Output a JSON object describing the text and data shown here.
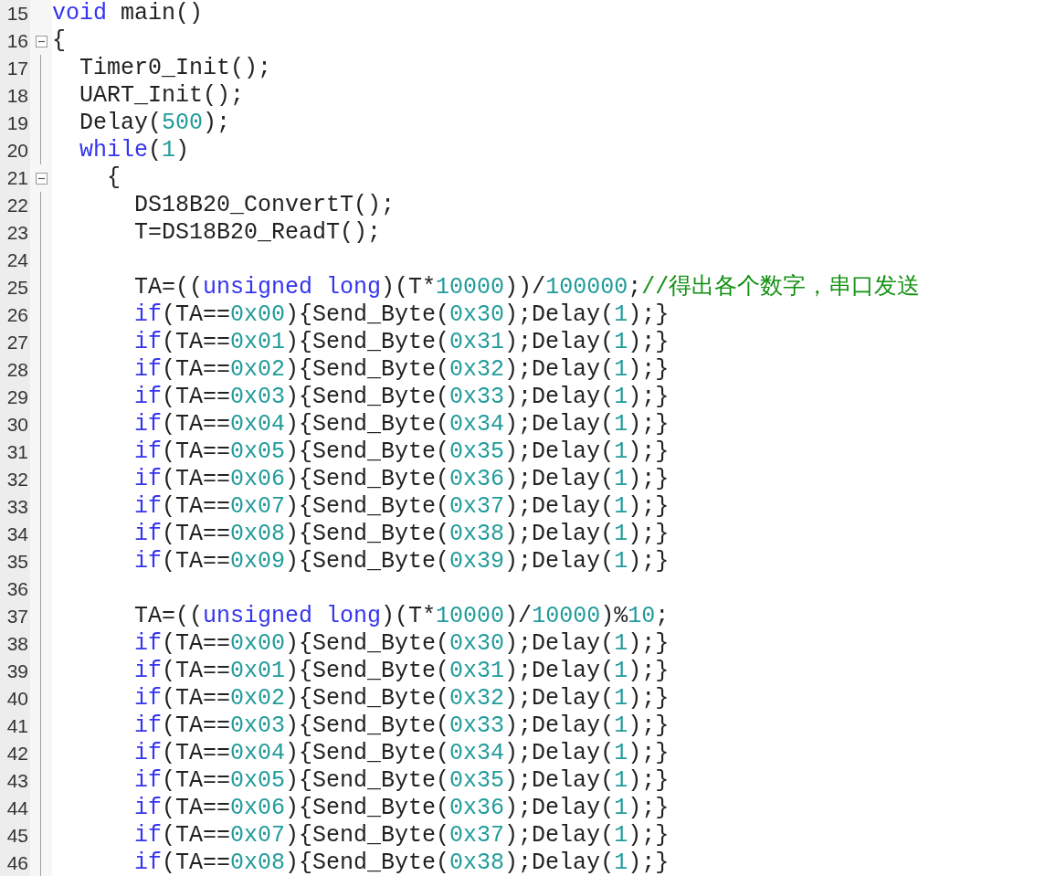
{
  "editor": {
    "lines": [
      {
        "number": "15",
        "fold_marker": false,
        "tokens": [
          {
            "kind": "keyword",
            "text": "void"
          },
          {
            "kind": "plain",
            "text": " main()"
          }
        ]
      },
      {
        "number": "16",
        "fold_marker": true,
        "tokens": [
          {
            "kind": "plain",
            "text": "{"
          }
        ]
      },
      {
        "number": "17",
        "fold_marker": false,
        "tokens": [
          {
            "kind": "plain",
            "text": "  Timer0_Init();"
          }
        ]
      },
      {
        "number": "18",
        "fold_marker": false,
        "tokens": [
          {
            "kind": "plain",
            "text": "  UART_Init();"
          }
        ]
      },
      {
        "number": "19",
        "fold_marker": false,
        "tokens": [
          {
            "kind": "plain",
            "text": "  Delay("
          },
          {
            "kind": "number",
            "text": "500"
          },
          {
            "kind": "plain",
            "text": ");"
          }
        ]
      },
      {
        "number": "20",
        "fold_marker": false,
        "tokens": [
          {
            "kind": "keyword",
            "text": "  while"
          },
          {
            "kind": "plain",
            "text": "("
          },
          {
            "kind": "number",
            "text": "1"
          },
          {
            "kind": "plain",
            "text": ")"
          }
        ]
      },
      {
        "number": "21",
        "fold_marker": true,
        "tokens": [
          {
            "kind": "plain",
            "text": "    {"
          }
        ]
      },
      {
        "number": "22",
        "fold_marker": false,
        "tokens": [
          {
            "kind": "plain",
            "text": "      DS18B20_ConvertT();"
          }
        ]
      },
      {
        "number": "23",
        "fold_marker": false,
        "tokens": [
          {
            "kind": "plain",
            "text": "      T=DS18B20_ReadT();"
          }
        ]
      },
      {
        "number": "24",
        "fold_marker": false
      },
      {
        "number": "25",
        "fold_marker": false,
        "tokens": [
          {
            "kind": "plain",
            "text": "      TA=(("
          },
          {
            "kind": "keyword",
            "text": "unsigned long"
          },
          {
            "kind": "plain",
            "text": ")(T*"
          },
          {
            "kind": "number",
            "text": "10000"
          },
          {
            "kind": "plain",
            "text": "))/"
          },
          {
            "kind": "number",
            "text": "100000"
          },
          {
            "kind": "plain",
            "text": ";"
          },
          {
            "kind": "comment",
            "text": "//得出各个数字，串口发送"
          }
        ]
      },
      {
        "number": "26",
        "fold_marker": false,
        "tokens": [
          {
            "kind": "keyword",
            "text": "      if"
          },
          {
            "kind": "plain",
            "text": "(TA=="
          },
          {
            "kind": "number",
            "text": "0x00"
          },
          {
            "kind": "plain",
            "text": "){Send_Byte("
          },
          {
            "kind": "number",
            "text": "0x30"
          },
          {
            "kind": "plain",
            "text": ");Delay("
          },
          {
            "kind": "number",
            "text": "1"
          },
          {
            "kind": "plain",
            "text": ");}"
          }
        ]
      },
      {
        "number": "27",
        "fold_marker": false,
        "tokens": [
          {
            "kind": "keyword",
            "text": "      if"
          },
          {
            "kind": "plain",
            "text": "(TA=="
          },
          {
            "kind": "number",
            "text": "0x01"
          },
          {
            "kind": "plain",
            "text": "){Send_Byte("
          },
          {
            "kind": "number",
            "text": "0x31"
          },
          {
            "kind": "plain",
            "text": ");Delay("
          },
          {
            "kind": "number",
            "text": "1"
          },
          {
            "kind": "plain",
            "text": ");}"
          }
        ]
      },
      {
        "number": "28",
        "fold_marker": false,
        "tokens": [
          {
            "kind": "keyword",
            "text": "      if"
          },
          {
            "kind": "plain",
            "text": "(TA=="
          },
          {
            "kind": "number",
            "text": "0x02"
          },
          {
            "kind": "plain",
            "text": "){Send_Byte("
          },
          {
            "kind": "number",
            "text": "0x32"
          },
          {
            "kind": "plain",
            "text": ");Delay("
          },
          {
            "kind": "number",
            "text": "1"
          },
          {
            "kind": "plain",
            "text": ");}"
          }
        ]
      },
      {
        "number": "29",
        "fold_marker": false,
        "tokens": [
          {
            "kind": "keyword",
            "text": "      if"
          },
          {
            "kind": "plain",
            "text": "(TA=="
          },
          {
            "kind": "number",
            "text": "0x03"
          },
          {
            "kind": "plain",
            "text": "){Send_Byte("
          },
          {
            "kind": "number",
            "text": "0x33"
          },
          {
            "kind": "plain",
            "text": ");Delay("
          },
          {
            "kind": "number",
            "text": "1"
          },
          {
            "kind": "plain",
            "text": ");}"
          }
        ]
      },
      {
        "number": "30",
        "fold_marker": false,
        "tokens": [
          {
            "kind": "keyword",
            "text": "      if"
          },
          {
            "kind": "plain",
            "text": "(TA=="
          },
          {
            "kind": "number",
            "text": "0x04"
          },
          {
            "kind": "plain",
            "text": "){Send_Byte("
          },
          {
            "kind": "number",
            "text": "0x34"
          },
          {
            "kind": "plain",
            "text": ");Delay("
          },
          {
            "kind": "number",
            "text": "1"
          },
          {
            "kind": "plain",
            "text": ");}"
          }
        ]
      },
      {
        "number": "31",
        "fold_marker": false,
        "tokens": [
          {
            "kind": "keyword",
            "text": "      if"
          },
          {
            "kind": "plain",
            "text": "(TA=="
          },
          {
            "kind": "number",
            "text": "0x05"
          },
          {
            "kind": "plain",
            "text": "){Send_Byte("
          },
          {
            "kind": "number",
            "text": "0x35"
          },
          {
            "kind": "plain",
            "text": ");Delay("
          },
          {
            "kind": "number",
            "text": "1"
          },
          {
            "kind": "plain",
            "text": ");}"
          }
        ]
      },
      {
        "number": "32",
        "fold_marker": false,
        "tokens": [
          {
            "kind": "keyword",
            "text": "      if"
          },
          {
            "kind": "plain",
            "text": "(TA=="
          },
          {
            "kind": "number",
            "text": "0x06"
          },
          {
            "kind": "plain",
            "text": "){Send_Byte("
          },
          {
            "kind": "number",
            "text": "0x36"
          },
          {
            "kind": "plain",
            "text": ");Delay("
          },
          {
            "kind": "number",
            "text": "1"
          },
          {
            "kind": "plain",
            "text": ");}"
          }
        ]
      },
      {
        "number": "33",
        "fold_marker": false,
        "tokens": [
          {
            "kind": "keyword",
            "text": "      if"
          },
          {
            "kind": "plain",
            "text": "(TA=="
          },
          {
            "kind": "number",
            "text": "0x07"
          },
          {
            "kind": "plain",
            "text": "){Send_Byte("
          },
          {
            "kind": "number",
            "text": "0x37"
          },
          {
            "kind": "plain",
            "text": ");Delay("
          },
          {
            "kind": "number",
            "text": "1"
          },
          {
            "kind": "plain",
            "text": ");}"
          }
        ]
      },
      {
        "number": "34",
        "fold_marker": false,
        "tokens": [
          {
            "kind": "keyword",
            "text": "      if"
          },
          {
            "kind": "plain",
            "text": "(TA=="
          },
          {
            "kind": "number",
            "text": "0x08"
          },
          {
            "kind": "plain",
            "text": "){Send_Byte("
          },
          {
            "kind": "number",
            "text": "0x38"
          },
          {
            "kind": "plain",
            "text": ");Delay("
          },
          {
            "kind": "number",
            "text": "1"
          },
          {
            "kind": "plain",
            "text": ");}"
          }
        ]
      },
      {
        "number": "35",
        "fold_marker": false,
        "tokens": [
          {
            "kind": "keyword",
            "text": "      if"
          },
          {
            "kind": "plain",
            "text": "(TA=="
          },
          {
            "kind": "number",
            "text": "0x09"
          },
          {
            "kind": "plain",
            "text": "){Send_Byte("
          },
          {
            "kind": "number",
            "text": "0x39"
          },
          {
            "kind": "plain",
            "text": ");Delay("
          },
          {
            "kind": "number",
            "text": "1"
          },
          {
            "kind": "plain",
            "text": ");}"
          }
        ]
      },
      {
        "number": "36",
        "fold_marker": false
      },
      {
        "number": "37",
        "fold_marker": false,
        "tokens": [
          {
            "kind": "plain",
            "text": "      TA=(("
          },
          {
            "kind": "keyword",
            "text": "unsigned long"
          },
          {
            "kind": "plain",
            "text": ")(T*"
          },
          {
            "kind": "number",
            "text": "10000"
          },
          {
            "kind": "plain",
            "text": ")/"
          },
          {
            "kind": "number",
            "text": "10000"
          },
          {
            "kind": "plain",
            "text": ")%"
          },
          {
            "kind": "number",
            "text": "10"
          },
          {
            "kind": "plain",
            "text": ";"
          }
        ]
      },
      {
        "number": "38",
        "fold_marker": false,
        "tokens": [
          {
            "kind": "keyword",
            "text": "      if"
          },
          {
            "kind": "plain",
            "text": "(TA=="
          },
          {
            "kind": "number",
            "text": "0x00"
          },
          {
            "kind": "plain",
            "text": "){Send_Byte("
          },
          {
            "kind": "number",
            "text": "0x30"
          },
          {
            "kind": "plain",
            "text": ");Delay("
          },
          {
            "kind": "number",
            "text": "1"
          },
          {
            "kind": "plain",
            "text": ");}"
          }
        ]
      },
      {
        "number": "39",
        "fold_marker": false,
        "tokens": [
          {
            "kind": "keyword",
            "text": "      if"
          },
          {
            "kind": "plain",
            "text": "(TA=="
          },
          {
            "kind": "number",
            "text": "0x01"
          },
          {
            "kind": "plain",
            "text": "){Send_Byte("
          },
          {
            "kind": "number",
            "text": "0x31"
          },
          {
            "kind": "plain",
            "text": ");Delay("
          },
          {
            "kind": "number",
            "text": "1"
          },
          {
            "kind": "plain",
            "text": ");}"
          }
        ]
      },
      {
        "number": "40",
        "fold_marker": false,
        "tokens": [
          {
            "kind": "keyword",
            "text": "      if"
          },
          {
            "kind": "plain",
            "text": "(TA=="
          },
          {
            "kind": "number",
            "text": "0x02"
          },
          {
            "kind": "plain",
            "text": "){Send_Byte("
          },
          {
            "kind": "number",
            "text": "0x32"
          },
          {
            "kind": "plain",
            "text": ");Delay("
          },
          {
            "kind": "number",
            "text": "1"
          },
          {
            "kind": "plain",
            "text": ");}"
          }
        ]
      },
      {
        "number": "41",
        "fold_marker": false,
        "tokens": [
          {
            "kind": "keyword",
            "text": "      if"
          },
          {
            "kind": "plain",
            "text": "(TA=="
          },
          {
            "kind": "number",
            "text": "0x03"
          },
          {
            "kind": "plain",
            "text": "){Send_Byte("
          },
          {
            "kind": "number",
            "text": "0x33"
          },
          {
            "kind": "plain",
            "text": ");Delay("
          },
          {
            "kind": "number",
            "text": "1"
          },
          {
            "kind": "plain",
            "text": ");}"
          }
        ]
      },
      {
        "number": "42",
        "fold_marker": false,
        "tokens": [
          {
            "kind": "keyword",
            "text": "      if"
          },
          {
            "kind": "plain",
            "text": "(TA=="
          },
          {
            "kind": "number",
            "text": "0x04"
          },
          {
            "kind": "plain",
            "text": "){Send_Byte("
          },
          {
            "kind": "number",
            "text": "0x34"
          },
          {
            "kind": "plain",
            "text": ");Delay("
          },
          {
            "kind": "number",
            "text": "1"
          },
          {
            "kind": "plain",
            "text": ");}"
          }
        ]
      },
      {
        "number": "43",
        "fold_marker": false,
        "tokens": [
          {
            "kind": "keyword",
            "text": "      if"
          },
          {
            "kind": "plain",
            "text": "(TA=="
          },
          {
            "kind": "number",
            "text": "0x05"
          },
          {
            "kind": "plain",
            "text": "){Send_Byte("
          },
          {
            "kind": "number",
            "text": "0x35"
          },
          {
            "kind": "plain",
            "text": ");Delay("
          },
          {
            "kind": "number",
            "text": "1"
          },
          {
            "kind": "plain",
            "text": ");}"
          }
        ]
      },
      {
        "number": "44",
        "fold_marker": false,
        "tokens": [
          {
            "kind": "keyword",
            "text": "      if"
          },
          {
            "kind": "plain",
            "text": "(TA=="
          },
          {
            "kind": "number",
            "text": "0x06"
          },
          {
            "kind": "plain",
            "text": "){Send_Byte("
          },
          {
            "kind": "number",
            "text": "0x36"
          },
          {
            "kind": "plain",
            "text": ");Delay("
          },
          {
            "kind": "number",
            "text": "1"
          },
          {
            "kind": "plain",
            "text": ");}"
          }
        ]
      },
      {
        "number": "45",
        "fold_marker": false,
        "tokens": [
          {
            "kind": "keyword",
            "text": "      if"
          },
          {
            "kind": "plain",
            "text": "(TA=="
          },
          {
            "kind": "number",
            "text": "0x07"
          },
          {
            "kind": "plain",
            "text": "){Send_Byte("
          },
          {
            "kind": "number",
            "text": "0x37"
          },
          {
            "kind": "plain",
            "text": ");Delay("
          },
          {
            "kind": "number",
            "text": "1"
          },
          {
            "kind": "plain",
            "text": ");}"
          }
        ]
      },
      {
        "number": "46",
        "fold_marker": false,
        "tokens": [
          {
            "kind": "keyword",
            "text": "      if"
          },
          {
            "kind": "plain",
            "text": "(TA=="
          },
          {
            "kind": "number",
            "text": "0x08"
          },
          {
            "kind": "plain",
            "text": "){Send_Byte("
          },
          {
            "kind": "number",
            "text": "0x38"
          },
          {
            "kind": "plain",
            "text": ");Delay("
          },
          {
            "kind": "number",
            "text": "1"
          },
          {
            "kind": "plain",
            "text": ");}"
          }
        ]
      }
    ]
  }
}
